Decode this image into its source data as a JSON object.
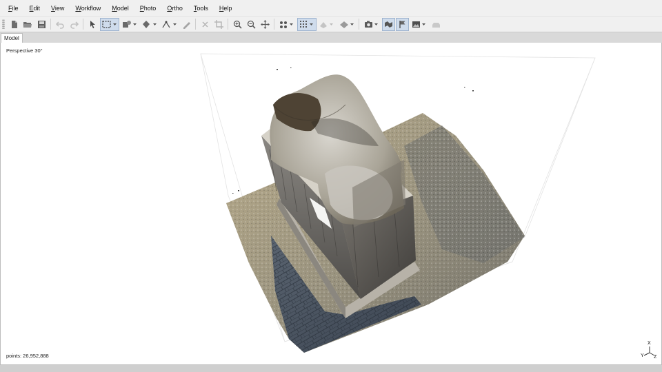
{
  "menu": [
    {
      "label": "File",
      "mnemonic": "F",
      "rest": "ile"
    },
    {
      "label": "Edit",
      "mnemonic": "E",
      "rest": "dit"
    },
    {
      "label": "View",
      "mnemonic": "V",
      "rest": "iew"
    },
    {
      "label": "Workflow",
      "mnemonic": "W",
      "rest": "orkflow"
    },
    {
      "label": "Model",
      "mnemonic": "M",
      "rest": "odel"
    },
    {
      "label": "Photo",
      "mnemonic": "P",
      "rest": "hoto"
    },
    {
      "label": "Ortho",
      "mnemonic": "O",
      "rest": "rtho"
    },
    {
      "label": "Tools",
      "mnemonic": "T",
      "rest": "ools"
    },
    {
      "label": "Help",
      "mnemonic": "H",
      "rest": "elp"
    }
  ],
  "toolbar_icons": [
    "new-document-icon",
    "open-folder-icon",
    "save-icon",
    "undo-icon",
    "redo-icon",
    "navigation-cursor-icon",
    "rectangle-selection-icon",
    "shape-tool-icon",
    "polygon-tool-icon",
    "ruler-icon",
    "draw-polyline-icon",
    "delete-selection-icon",
    "crop-icon",
    "zoom-in-icon",
    "zoom-out-icon",
    "move-icon",
    "point-cloud-icon",
    "dense-cloud-icon",
    "mesh-icon",
    "model-icon",
    "camera-icon",
    "show-markers-icon",
    "show-flags-icon",
    "show-image-icon",
    "show-region-icon"
  ],
  "tab": {
    "label": "Model"
  },
  "viewport": {
    "projection_label": "Perspective 30°",
    "points_label": "points: 26,952,888"
  },
  "axes": {
    "x": "X",
    "y": "Y",
    "z": "Z"
  },
  "colors": {
    "toolbar_active": "#cfdcec",
    "chrome": "#f0f0f0"
  }
}
